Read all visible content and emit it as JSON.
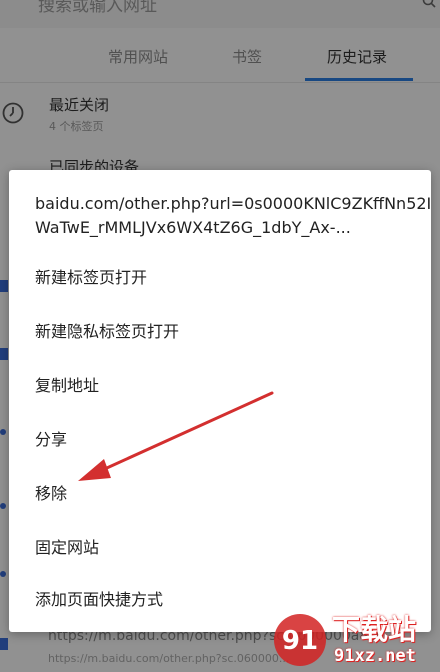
{
  "search": {
    "placeholder": "搜索或输入网址"
  },
  "tabs": [
    {
      "label": "常用网站"
    },
    {
      "label": "书签"
    },
    {
      "label": "历史记录",
      "active": true
    }
  ],
  "history": {
    "recently_closed": {
      "title": "最近关闭",
      "subtitle": "4 个标签页"
    },
    "synced_devices": {
      "title": "已同步的设备"
    },
    "bottom_url": "https://m.baidu.com/other.php?sc.0600000a8sc",
    "bottom_url_small": "https://m.baidu.com/other.php?sc.060000..."
  },
  "context_menu": {
    "url_text": "baidu.com/other.php?url=0s0000KNlC9ZKffNn52IWaTwE_rMMLJVx6WX4tZ6G_1dbY_Ax-...",
    "items": [
      {
        "label": "新建标签页打开"
      },
      {
        "label": "新建隐私标签页打开"
      },
      {
        "label": "复制地址"
      },
      {
        "label": "分享"
      },
      {
        "label": "移除"
      },
      {
        "label": "固定网站"
      },
      {
        "label": "添加页面快捷方式"
      }
    ]
  },
  "watermark": {
    "main": "下载站",
    "domain": "91xz.net",
    "badge": "91"
  },
  "colors": {
    "accent": "#2a7de1",
    "annotation_arrow": "#d32f2f",
    "watermark_red": "#d22222"
  }
}
